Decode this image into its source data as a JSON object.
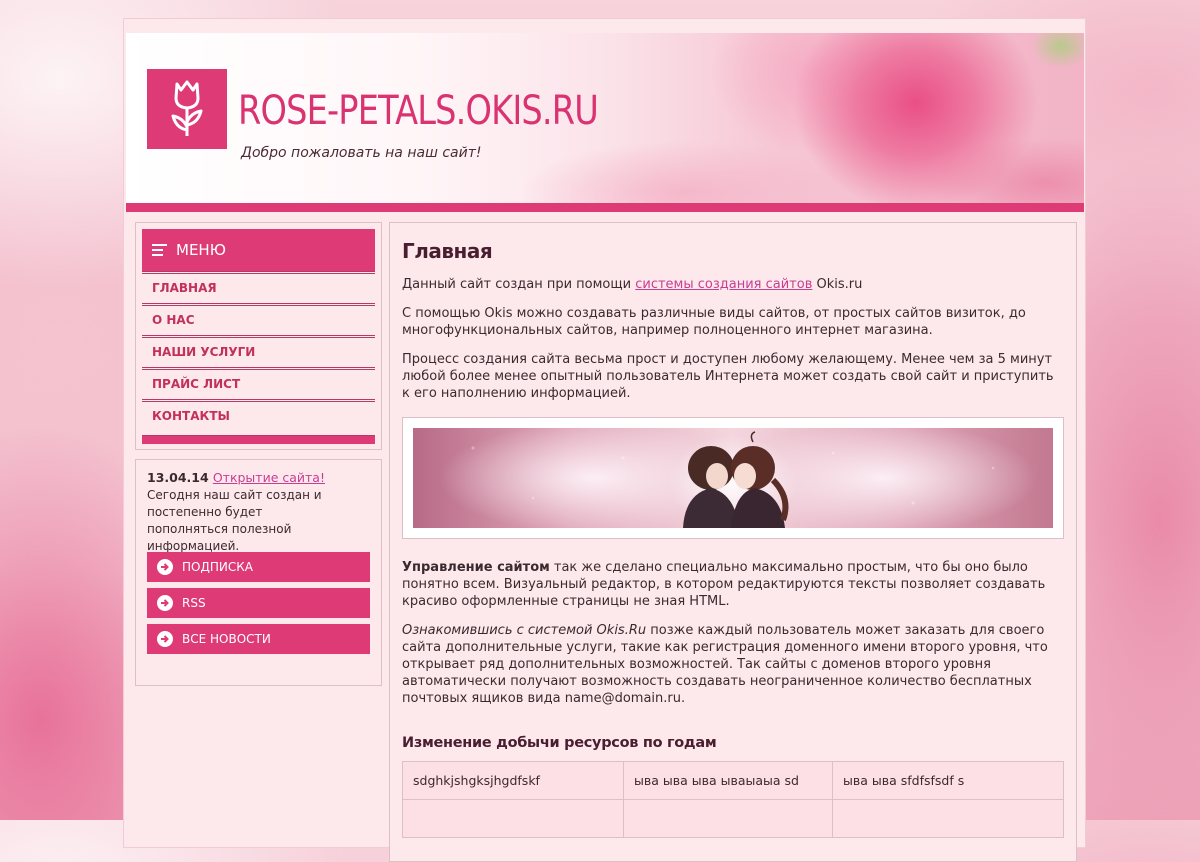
{
  "header": {
    "site_title": "ROSE-PETALS.OKIS.RU",
    "slogan": "Добро пожаловать на наш сайт!",
    "logo_icon": "tulip-icon"
  },
  "menu": {
    "title": "МЕНЮ",
    "items": [
      {
        "label": "ГЛАВНАЯ"
      },
      {
        "label": "О НАС"
      },
      {
        "label": "НАШИ УСЛУГИ"
      },
      {
        "label": "ПРАЙС ЛИСТ"
      },
      {
        "label": "КОНТАКТЫ"
      }
    ]
  },
  "news": {
    "date": "13.04.14",
    "title": "Открытие сайта!",
    "text": "Сегодня наш сайт создан и постепенно будет пополняться полезной информацией.",
    "buttons": [
      {
        "label": "ПОДПИСКА"
      },
      {
        "label": "RSS"
      },
      {
        "label": "ВСЕ НОВОСТИ"
      }
    ]
  },
  "content": {
    "title": "Главная",
    "p1_before": "Данный сайт создан при помощи ",
    "p1_link": "системы создания сайтов",
    "p1_after": " Okis.ru",
    "p2": "С помощью Okis можно создавать различные виды сайтов, от простых сайтов визиток, до многофункциональных сайтов, например полноценного интернет магазина.",
    "p3": "Процесс создания сайта весьма прост и доступен любому желающему. Менее чем за 5 минут любой более менее опытный пользователь Интернета может создать свой сайт и приступить к его наполнению информацией.",
    "p4_bold": "Управление сайтом",
    "p4_rest": " так же сделано специально максимально простым, что бы оно было понятно всем. Визуальный редактор, в котором редактируются тексты позволяет создавать красиво оформленные страницы не зная HTML.",
    "p5_italic": "Ознакомившись с системой Okis.Ru",
    "p5_rest": " позже каждый пользователь может заказать для своего сайта дополнительные услуги, такие как регистрация доменного имени второго уровня, что открывает ряд дополнительных возможностей. Так сайты с доменов второго уровня автоматически получают возможность создавать неограниченное количество бесплатных почтовых ящиков вида name@domain.ru.",
    "table_title": "Изменение добычи ресурсов по годам",
    "table_rows": [
      [
        "sdghkjshgksjhgdfskf",
        "ыва ыва ыва ывaыaыa sd",
        "ыва ыва sfdfsfsdf s"
      ],
      [
        "",
        "",
        ""
      ]
    ]
  },
  "colors": {
    "accent": "#de3b76",
    "title": "#d93471",
    "link": "#c83d92",
    "panel_bg": "#fde9ec"
  }
}
